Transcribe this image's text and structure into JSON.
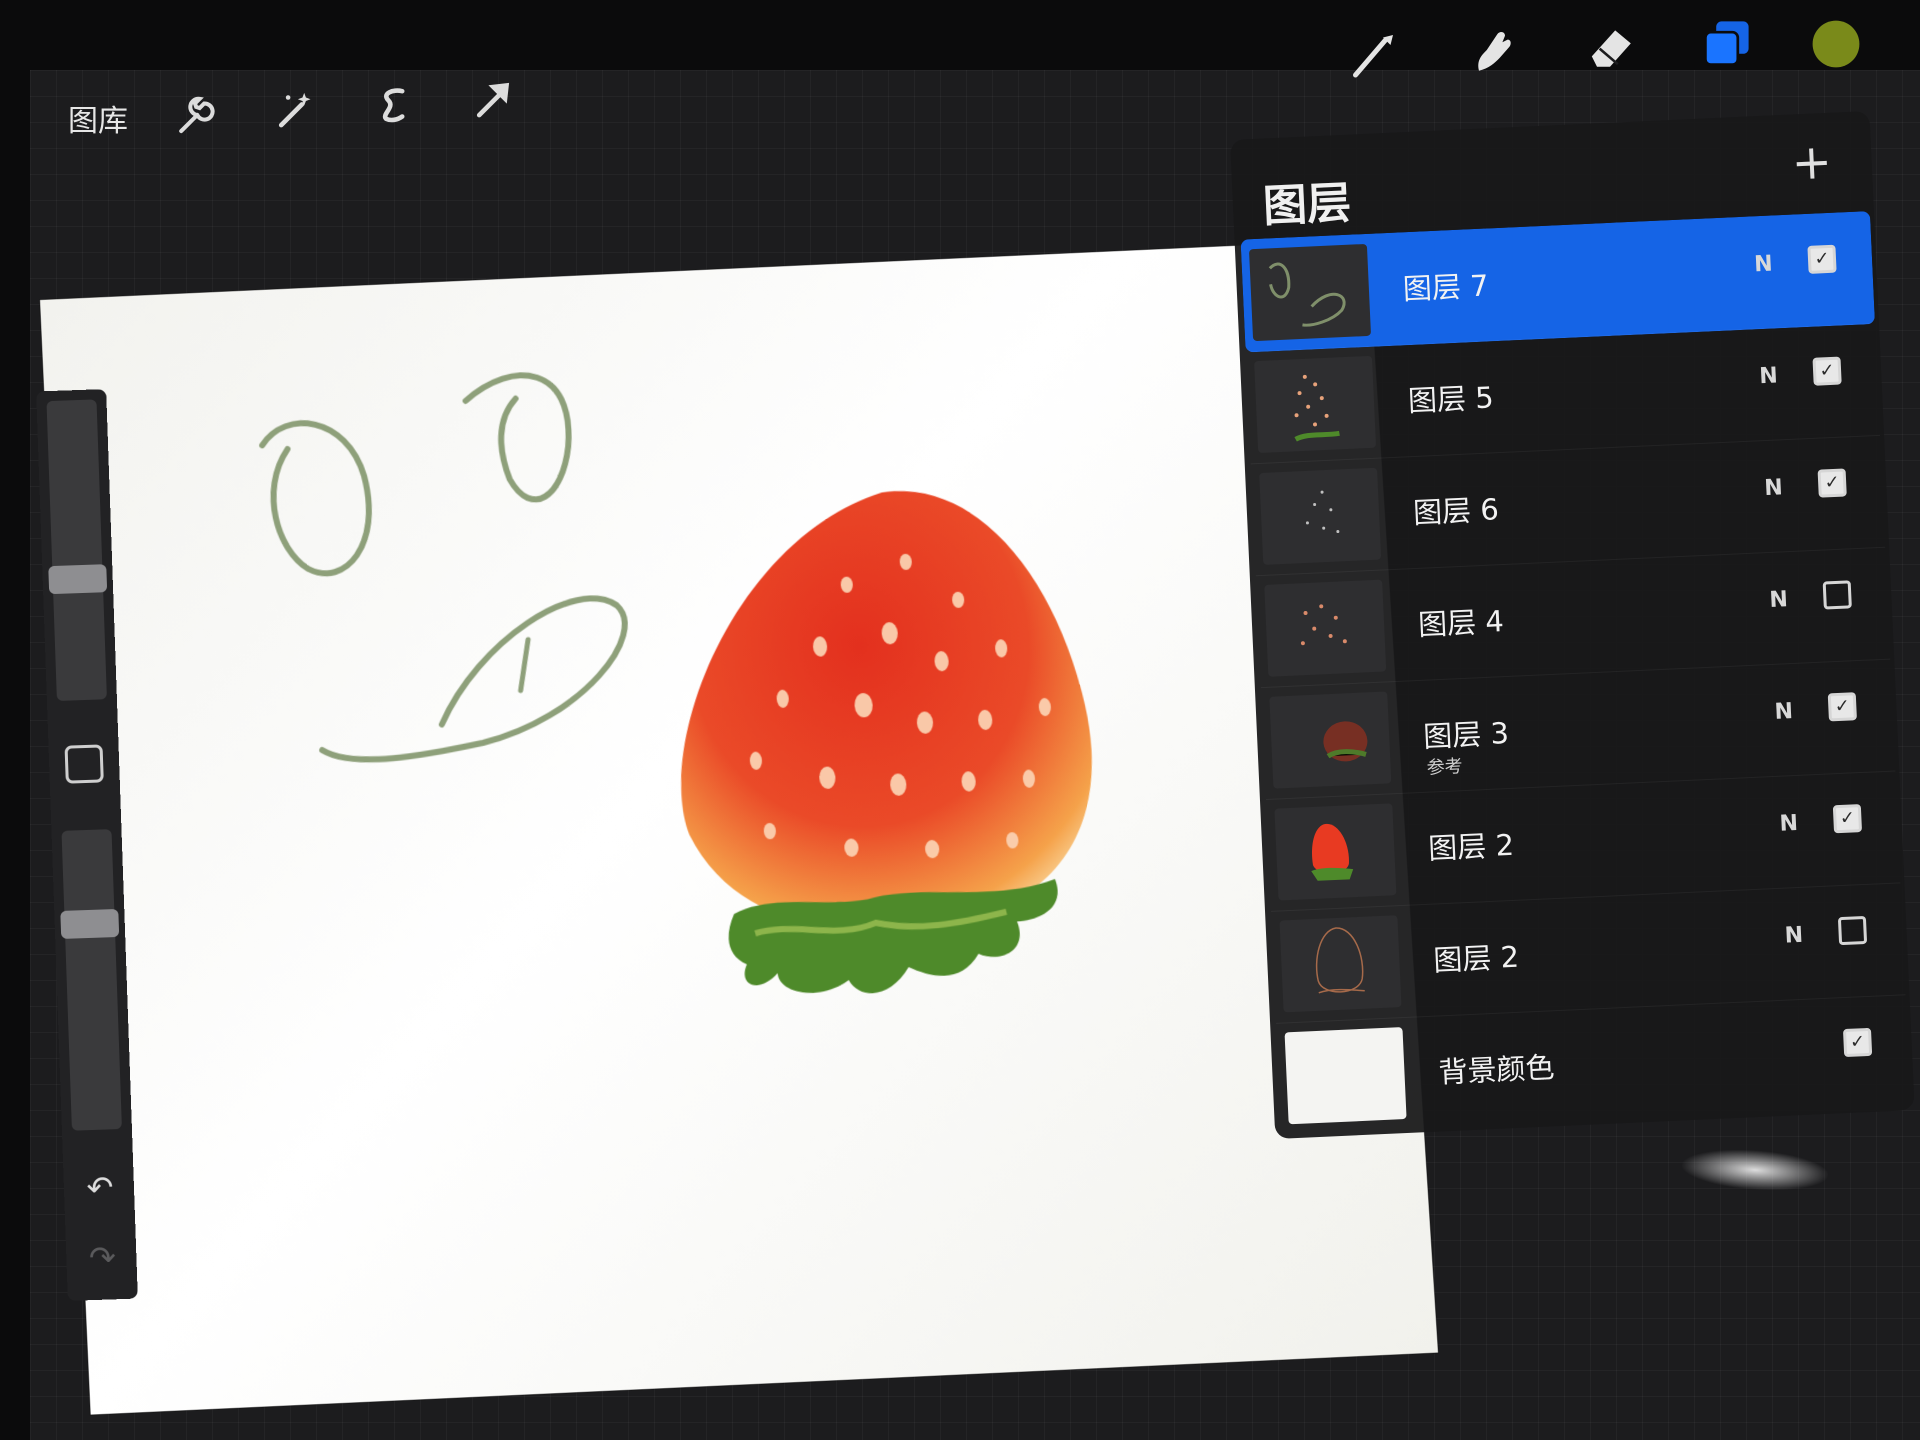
{
  "toolbar": {
    "gallery_label": "图库",
    "left_icons": [
      "wrench-icon",
      "magic-wand-icon",
      "selection-icon",
      "transform-arrow-icon"
    ],
    "right_icons": [
      "brush-icon",
      "smudge-icon",
      "eraser-icon",
      "layers-icon",
      "color-swatch-icon"
    ],
    "current_color": "#7a8a1a",
    "accent": "#1564e6"
  },
  "layers": {
    "title": "图层",
    "add_label": "+",
    "items": [
      {
        "name": "图层 7",
        "sub": "",
        "blend": "N",
        "visible": true,
        "active": true
      },
      {
        "name": "图层 5",
        "sub": "",
        "blend": "N",
        "visible": true,
        "active": false
      },
      {
        "name": "图层 6",
        "sub": "",
        "blend": "N",
        "visible": true,
        "active": false
      },
      {
        "name": "图层 4",
        "sub": "",
        "blend": "N",
        "visible": false,
        "active": false
      },
      {
        "name": "图层 3",
        "sub": "参考",
        "blend": "N",
        "visible": true,
        "active": false
      },
      {
        "name": "图层 2",
        "sub": "",
        "blend": "N",
        "visible": true,
        "active": false
      },
      {
        "name": "图层 2",
        "sub": "",
        "blend": "N",
        "visible": false,
        "active": false
      },
      {
        "name": "背景颜色",
        "sub": "",
        "blend": "",
        "visible": true,
        "active": false
      }
    ]
  },
  "sidebar": {
    "brush_size": 0.55,
    "opacity": 0.7,
    "undo_icon": "undo-icon",
    "redo_icon": "redo-icon"
  },
  "canvas": {
    "subject": "strawberry",
    "stroke_color": "#8ea07a",
    "fruit_color": "#e8452a",
    "leaf_color": "#4e8a2a"
  }
}
